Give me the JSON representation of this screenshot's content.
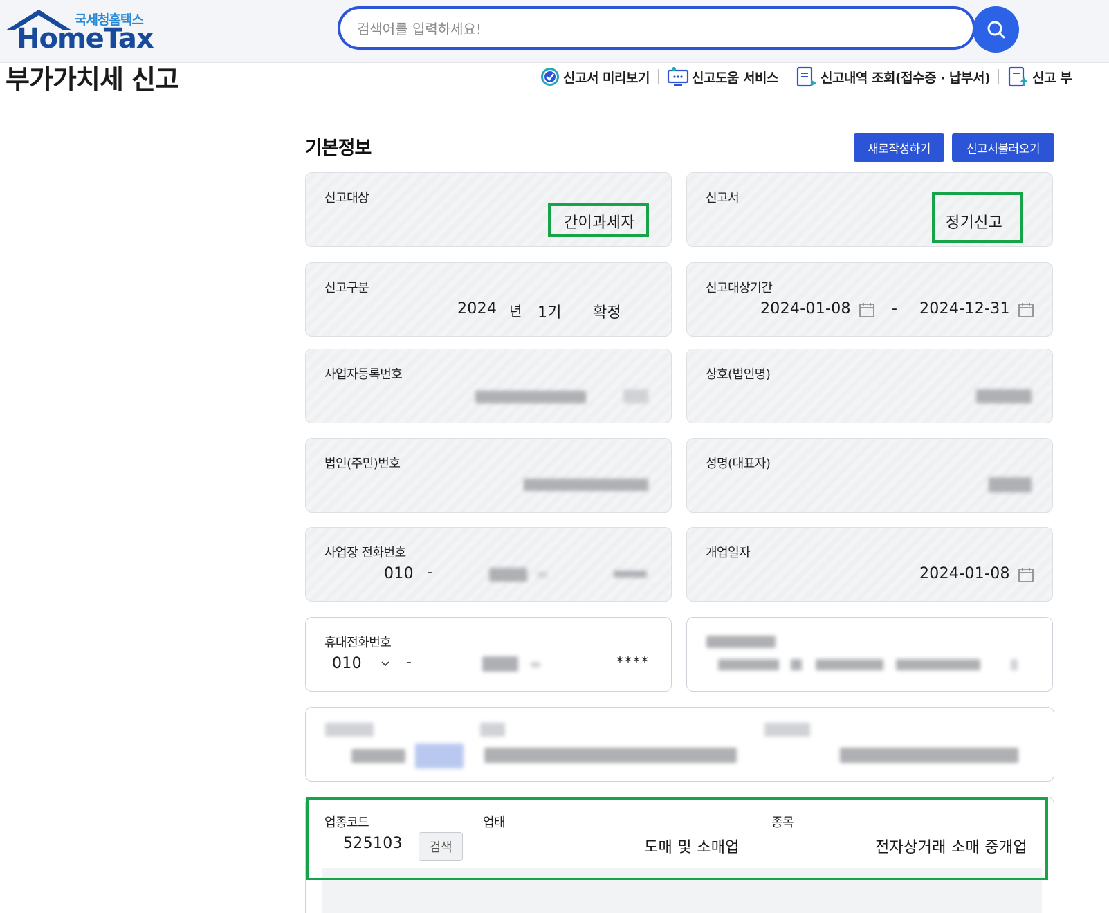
{
  "header": {
    "logo_sub": "국세청홈택스",
    "logo_main": "HomeTax",
    "search_placeholder": "검색어를 입력하세요!"
  },
  "page_title": "부가가치세 신고",
  "quick_menu": [
    {
      "label": "신고서 미리보기",
      "icon": "check-circle-icon"
    },
    {
      "label": "신고도움 서비스",
      "icon": "monitor-help-icon"
    },
    {
      "label": "신고내역 조회(접수증 · 납부서)",
      "icon": "document-list-icon"
    },
    {
      "label": "신고 부",
      "icon": "document-upload-icon"
    }
  ],
  "section": {
    "title": "기본정보",
    "new_button": "새로작성하기",
    "load_button": "신고서불러오기"
  },
  "fields": {
    "target": {
      "label": "신고대상",
      "value": "간이과세자"
    },
    "report_type": {
      "label": "신고서",
      "value": "정기신고"
    },
    "division": {
      "label": "신고구분",
      "year": "2024",
      "year_unit": "년",
      "term": "1기",
      "status": "확정"
    },
    "period": {
      "label": "신고대상기간",
      "start": "2024-01-08",
      "dash": "-",
      "end": "2024-12-31"
    },
    "biz_reg_no": {
      "label": "사업자등록번호"
    },
    "company_name": {
      "label": "상호(법인명)"
    },
    "corp_id_no": {
      "label": "법인(주민)번호"
    },
    "rep_name": {
      "label": "성명(대표자)"
    },
    "biz_phone": {
      "label": "사업장 전화번호",
      "prefix": "010",
      "dash": "-"
    },
    "open_date": {
      "label": "개업일자",
      "value": "2024-01-08"
    },
    "mobile": {
      "label": "휴대전화번호",
      "prefix": "010",
      "dash": "-",
      "masked": "****"
    },
    "industry": {
      "code_label": "업종코드",
      "code": "525103",
      "search_button": "검색",
      "type_label": "업태",
      "type_value": "도매 및 소매업",
      "item_label": "종목",
      "item_value": "전자상거래 소매 중개업"
    }
  },
  "colors": {
    "primary_blue": "#2b55d6",
    "highlight_green": "#16a34a",
    "logo_blue": "#174a9a"
  }
}
